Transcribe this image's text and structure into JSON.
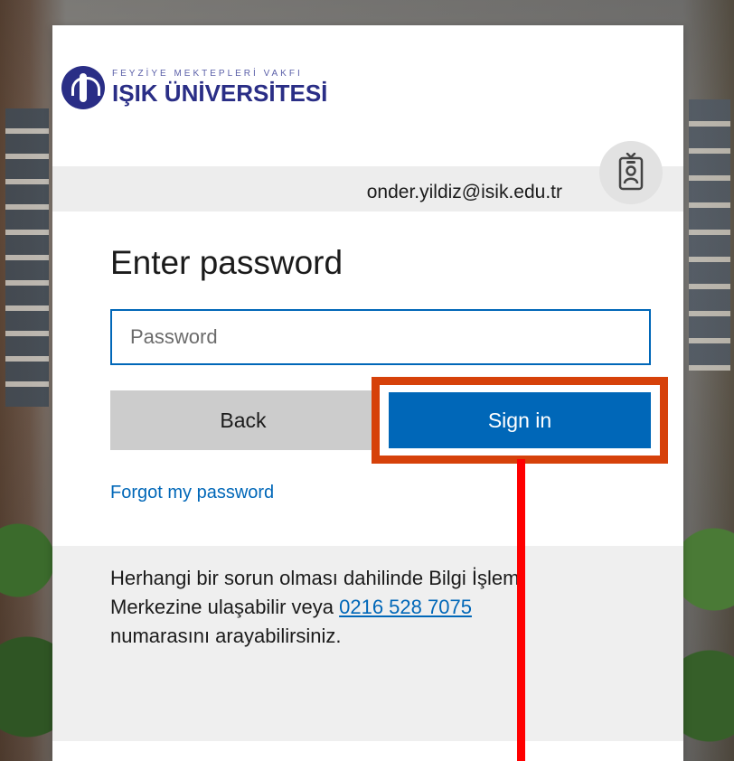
{
  "branding": {
    "tagline": "FEYZİYE MEKTEPLERİ VAKFI",
    "university_name": "IŞIK ÜNİVERSİTESİ"
  },
  "identity": {
    "email": "onder.yildiz@isik.edu.tr",
    "badge_icon": "id-badge-icon"
  },
  "signin_form": {
    "heading": "Enter password",
    "password_placeholder": "Password",
    "password_value": "",
    "back_label": "Back",
    "signin_label": "Sign in",
    "forgot_password_label": "Forgot my password"
  },
  "footer": {
    "help_text_before": "Herhangi bir sorun olması dahilinde Bilgi İşlem Merkezine ulaşabilir veya ",
    "phone_number": "0216 528 7075",
    "help_text_after": " numarasını arayabilirsiniz."
  },
  "colors": {
    "accent_blue": "#0067b8",
    "brand_navy": "#2a2e86",
    "highlight_orange": "#d6410a",
    "annotation_red": "#ff0000"
  }
}
